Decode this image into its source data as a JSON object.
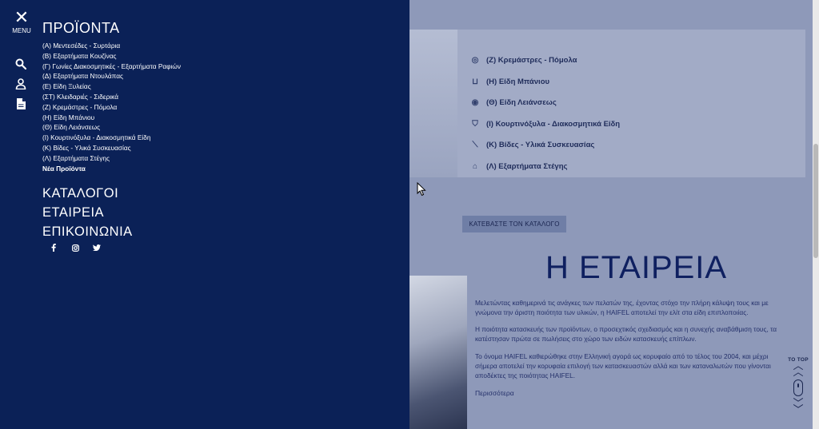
{
  "menu": {
    "menu_label": "MENU",
    "products_title": "ΠΡΟΪΟΝΤΑ",
    "products": [
      "(Α) Μεντεσέδες - Συρτάρια",
      "(Β) Εξαρτήματα Κουζίνας",
      "(Γ) Γωνίες Διακοσμητικές - Εξαρτήματα Ραφιών",
      "(Δ) Εξαρτήματα Ντουλάπας",
      "(Ε) Είδη Ξυλείας",
      "(ΣΤ) Κλειδαριές - Σιδερικά",
      "(Ζ) Κρεμάστρες - Πόμολα",
      "(Η) Είδη Μπάνιου",
      "(Θ) Είδη Λειάνσεως",
      "(Ι) Κουρτινόξυλα - Διακοσμητικά Είδη",
      "(Κ) Βίδες - Υλικά Συσκευασίας",
      "(Λ) Εξαρτήματα Στέγης"
    ],
    "new_products": "Νέα Προϊόντα",
    "catalogs": "ΚΑΤΑΛΟΓΟΙ",
    "company": "ΕΤΑΙΡΕΙΑ",
    "contact": "ΕΠΙΚΟΙΝΩΝΙΑ",
    "social": [
      "f",
      "ig",
      "tw"
    ]
  },
  "background": {
    "categories": [
      {
        "label": "(Ζ) Κρεμάστρες - Πόμολα",
        "icon": "knob-icon"
      },
      {
        "label": "(Η) Είδη Μπάνιου",
        "icon": "bath-icon"
      },
      {
        "label": "(Θ) Είδη Λειάνσεως",
        "icon": "sanding-icon"
      },
      {
        "label": "(Ι) Κουρτινόξυλα - Διακοσμητικά Είδη",
        "icon": "curtain-icon"
      },
      {
        "label": "(Κ) Βίδες - Υλικά Συσκευασίας",
        "icon": "screw-icon"
      },
      {
        "label": "(Λ) Εξαρτήματα Στέγης",
        "icon": "roof-icon"
      }
    ],
    "download_button": "ΚΑΤΕΒΑΣΤΕ ΤΟΝ ΚΑΤΑΛΟΓΟ",
    "company_title": "Η ΕΤΑΙΡΕΙΑ",
    "paragraphs": [
      "Μελετώντας καθημερινά τις ανάγκες των πελατών της, έχοντας στόχο την πλήρη κάλυψη τους και με γνώμονα την άριστη ποιότητα των υλικών, η HAIFEL αποτελεί την ελίτ στα είδη επιπλοποιίας.",
      "Η ποιότητα κατασκευής των προϊόντων, ο προσεχτικός σχεδιασμός και η συνεχής αναβάθμιση τους, τα κατέστησαν πρώτα σε πωλήσεις στο χώρο των ειδών κατασκευής επίπλων.",
      "Το όνομα HAIFEL καθιερώθηκε στην Ελληνική αγορά ως κορυφαίο από το τέλος του 2004, και μέχρι σήμερα αποτελεί την κορυφαία επιλογή των κατασκευαστών αλλά και των καταναλωτών που γίνονται αποδέκτες της ποιότητας HAIFEL."
    ],
    "more_link": "Περισσότερα",
    "to_top": "TO TOP"
  }
}
